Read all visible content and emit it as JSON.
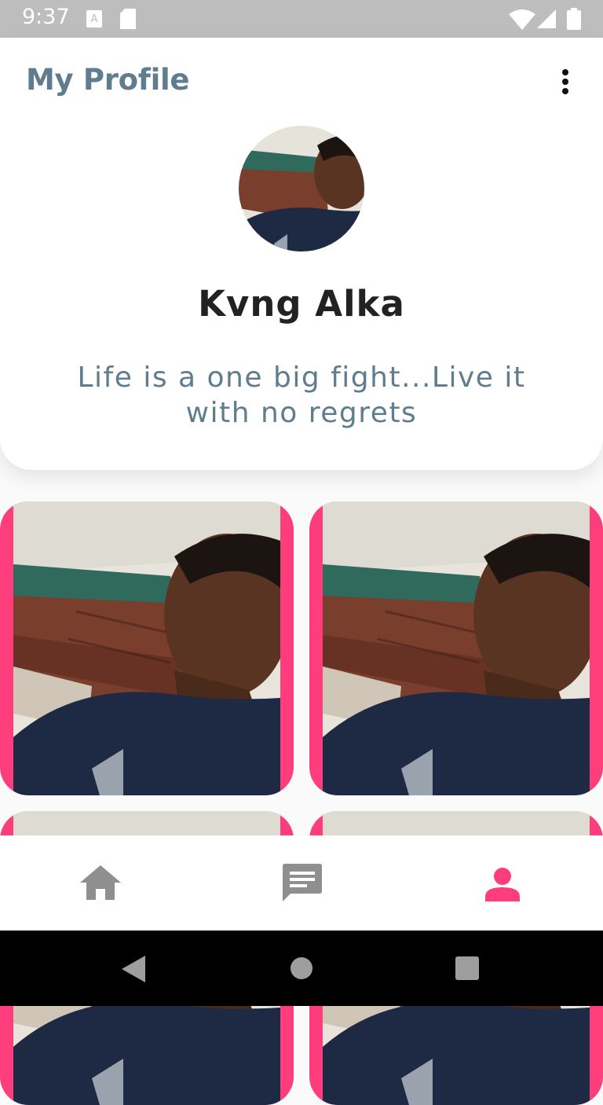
{
  "status_bar": {
    "time": "9:37",
    "icons": [
      "a-icon",
      "sd-card-icon",
      "wifi-icon",
      "signal-icon",
      "battery-icon"
    ]
  },
  "header": {
    "title": "My Profile",
    "menu_icon": "more-vert-icon"
  },
  "profile": {
    "name": "Kvng Alka",
    "bio": "Life is a one big fight...Live it with no regrets"
  },
  "colors": {
    "accent": "#fd3d7c",
    "title": "#5f7d8e",
    "status_bar": "#bdbdbd",
    "nav_inactive": "#8f8f8f"
  },
  "bottom_nav": {
    "items": [
      {
        "icon": "home-icon",
        "active": false
      },
      {
        "icon": "chat-icon",
        "active": false
      },
      {
        "icon": "person-icon",
        "active": true
      }
    ]
  },
  "system_nav": [
    "back-icon",
    "home-circle-icon",
    "recents-icon"
  ]
}
